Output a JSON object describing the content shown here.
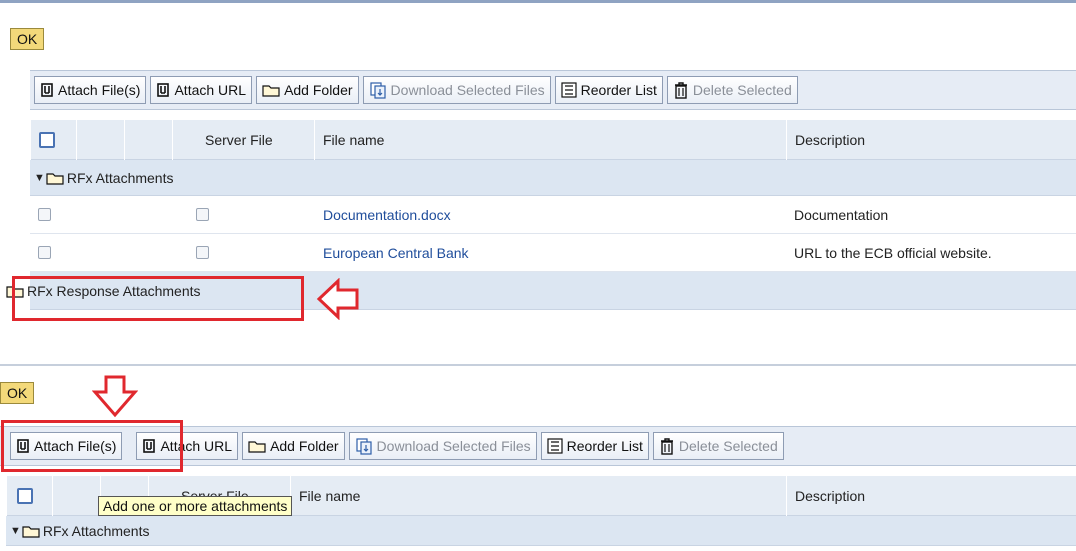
{
  "ok_label": "OK",
  "toolbar": {
    "attach_files": "Attach File(s)",
    "attach_url": "Attach URL",
    "add_folder": "Add Folder",
    "download_selected": "Download Selected Files",
    "reorder_list": "Reorder List",
    "delete_selected": "Delete Selected"
  },
  "table": {
    "columns": {
      "server_file": "Server File",
      "file_name": "File name",
      "description": "Description"
    },
    "folder_rfx": "RFx Attachments",
    "rows": [
      {
        "file_name": "Documentation.docx",
        "description": "Documentation"
      },
      {
        "file_name": "European Central Bank",
        "description": "URL to the ECB official website."
      }
    ],
    "folder_response": "RFx Response Attachments"
  },
  "panel2": {
    "header_partial_server": "Server File",
    "header_partial_filename": "File name",
    "tooltip": "Add one or more attachments"
  },
  "colors": {
    "highlight": "#e0282e",
    "ok_button": "#f3d97a",
    "toolbar_bg": "#e6ecf5",
    "link": "#1f4d9b"
  }
}
